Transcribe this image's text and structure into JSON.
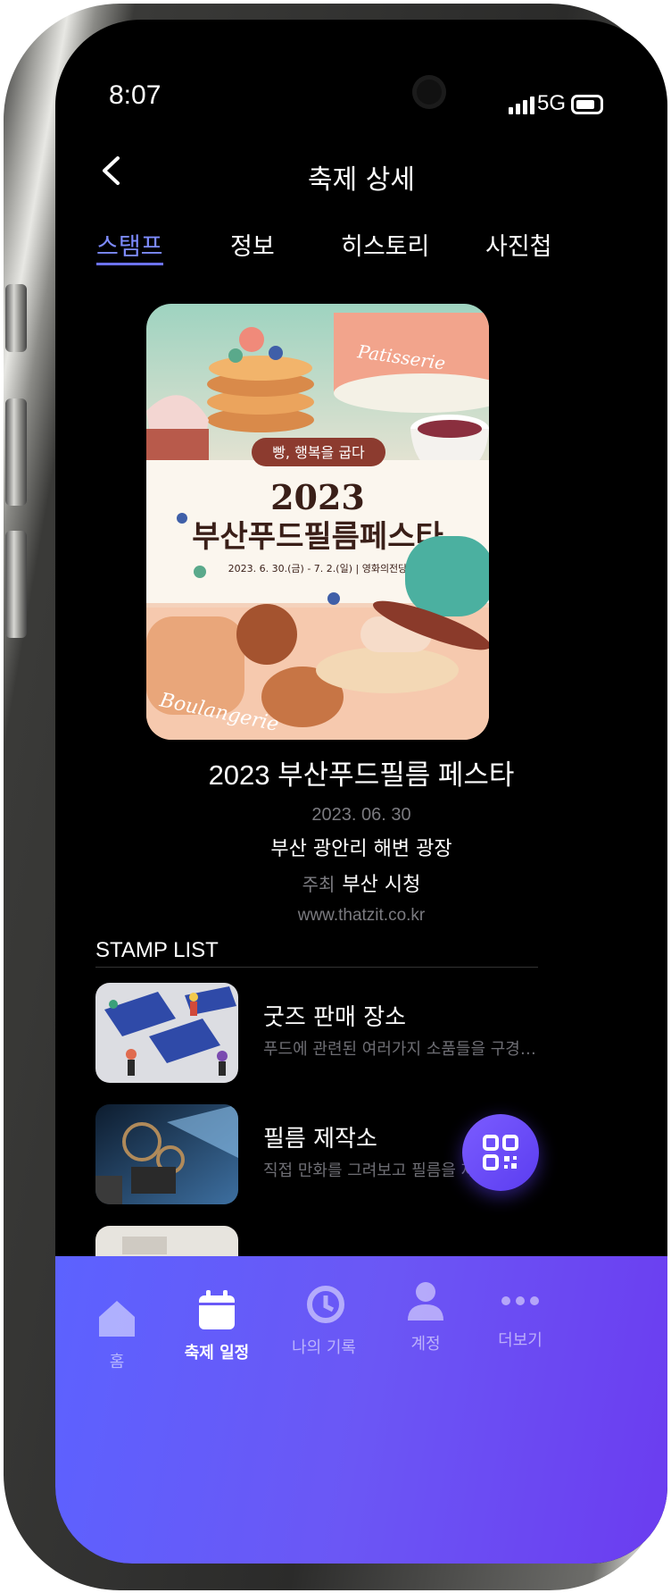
{
  "status": {
    "time": "8:07",
    "network": "5G"
  },
  "header": {
    "title": "축제 상세"
  },
  "tabs": [
    {
      "label": "스탬프",
      "active": true
    },
    {
      "label": "정보",
      "active": false
    },
    {
      "label": "히스토리",
      "active": false
    },
    {
      "label": "사진첩",
      "active": false
    }
  ],
  "poster": {
    "tagline": "빵, 행복을 굽다",
    "year": "2023",
    "name": "부산푸드필름페스타",
    "dates": "2023. 6. 30.(금) - 7. 2.(일)  |  영화의전당",
    "script_left": "Boulangerie",
    "script_right": "Patisserie"
  },
  "festival": {
    "title": "2023 부산푸드필름 페스타",
    "date": "2023. 06. 30",
    "place": "부산 광안리 해변 광장",
    "host_label": "주최",
    "host": "부산 시청",
    "url": "www.thatzit.co.kr"
  },
  "stamp_list": {
    "header": "STAMP LIST",
    "items": [
      {
        "title": "굿즈 판매 장소",
        "desc": "푸드에 관련된 여러가지 소품들을 구경하면..."
      },
      {
        "title": "필름 제작소",
        "desc": "직접 만화를 그려보고 필름을 제작"
      }
    ]
  },
  "bottom_nav": [
    {
      "label": "홈",
      "icon": "home-icon",
      "active": false
    },
    {
      "label": "축제 일정",
      "icon": "calendar-icon",
      "active": true
    },
    {
      "label": "나의 기록",
      "icon": "history-icon",
      "active": false
    },
    {
      "label": "계정",
      "icon": "user-icon",
      "active": false
    },
    {
      "label": "더보기",
      "icon": "more-icon",
      "active": false
    }
  ],
  "colors": {
    "accent": "#6c72ff",
    "nav_gradient_start": "#5c62ff",
    "nav_gradient_end": "#6b3cf0"
  }
}
